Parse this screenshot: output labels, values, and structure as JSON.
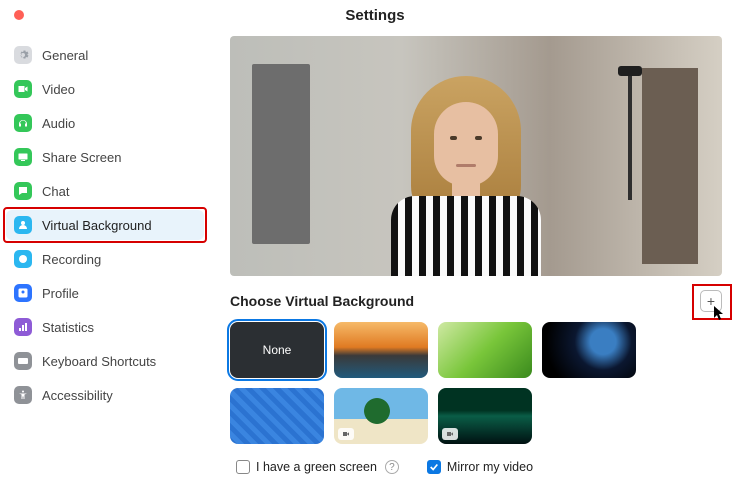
{
  "title": "Settings",
  "sidebar": {
    "items": [
      {
        "label": "General",
        "icon": "gear",
        "color": "#d9dbdf"
      },
      {
        "label": "Video",
        "icon": "camera",
        "color": "#34c759"
      },
      {
        "label": "Audio",
        "icon": "headphones",
        "color": "#34c759"
      },
      {
        "label": "Share Screen",
        "icon": "screen",
        "color": "#34c759"
      },
      {
        "label": "Chat",
        "icon": "chat",
        "color": "#34c759"
      },
      {
        "label": "Virtual Background",
        "icon": "person",
        "color": "#2bb7f0",
        "selected": true,
        "highlight": true
      },
      {
        "label": "Recording",
        "icon": "record",
        "color": "#2bb7f0"
      },
      {
        "label": "Profile",
        "icon": "profile",
        "color": "#2d74ff"
      },
      {
        "label": "Statistics",
        "icon": "stats",
        "color": "#8e5bd6"
      },
      {
        "label": "Keyboard Shortcuts",
        "icon": "keyboard",
        "color": "#8f9297"
      },
      {
        "label": "Accessibility",
        "icon": "access",
        "color": "#8f9297"
      }
    ]
  },
  "main": {
    "section_title": "Choose Virtual Background",
    "add_glyph": "+",
    "thumbs": [
      {
        "label": "None",
        "kind": "none",
        "selected": true
      },
      {
        "kind": "bridge"
      },
      {
        "kind": "grass"
      },
      {
        "kind": "earth"
      },
      {
        "kind": "pattern"
      },
      {
        "kind": "beach",
        "video": true
      },
      {
        "kind": "aurora",
        "video": true
      }
    ],
    "checks": {
      "green_screen": {
        "label": "I have a green screen",
        "checked": false,
        "help": "?"
      },
      "mirror": {
        "label": "Mirror my video",
        "checked": true
      }
    }
  }
}
